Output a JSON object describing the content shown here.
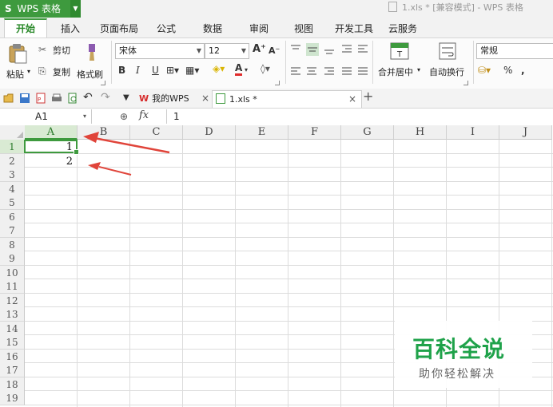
{
  "window": {
    "app_logo": "S",
    "app_name": "WPS 表格",
    "doc_title": "1.xls * [兼容模式] - WPS 表格"
  },
  "ribbon_tabs": [
    "开始",
    "插入",
    "页面布局",
    "公式",
    "数据",
    "审阅",
    "视图",
    "开发工具",
    "云服务"
  ],
  "active_tab": "开始",
  "clipboard": {
    "paste": "粘贴",
    "cut": "剪切",
    "copy": "复制",
    "format_painter": "格式刷"
  },
  "font": {
    "name": "宋体",
    "size": "12"
  },
  "alignment": {
    "merge_center": "合并居中",
    "wrap_text": "自动换行"
  },
  "number": {
    "format": "常规"
  },
  "doc_tabs": [
    {
      "label": "我的WPS"
    },
    {
      "label": "1.xls *"
    }
  ],
  "formula_bar": {
    "cell_ref": "A1",
    "fx": "fx",
    "value": "1"
  },
  "sheet": {
    "columns": [
      "A",
      "B",
      "C",
      "D",
      "E",
      "F",
      "G",
      "H",
      "I",
      "J"
    ],
    "rows": [
      "1",
      "2",
      "3",
      "4",
      "5",
      "6",
      "7",
      "8",
      "9",
      "10",
      "11",
      "12",
      "13",
      "14",
      "15",
      "16",
      "17",
      "18",
      "19"
    ],
    "cells": {
      "A1": "1",
      "A2": "2"
    },
    "selected_cell": "A1"
  },
  "watermark": {
    "title": "百科全说",
    "subtitle": "助你轻松解决"
  },
  "colors": {
    "accent": "#3e9a3e",
    "annotation_arrow": "#e0443a",
    "watermark": "#1fa24a"
  }
}
